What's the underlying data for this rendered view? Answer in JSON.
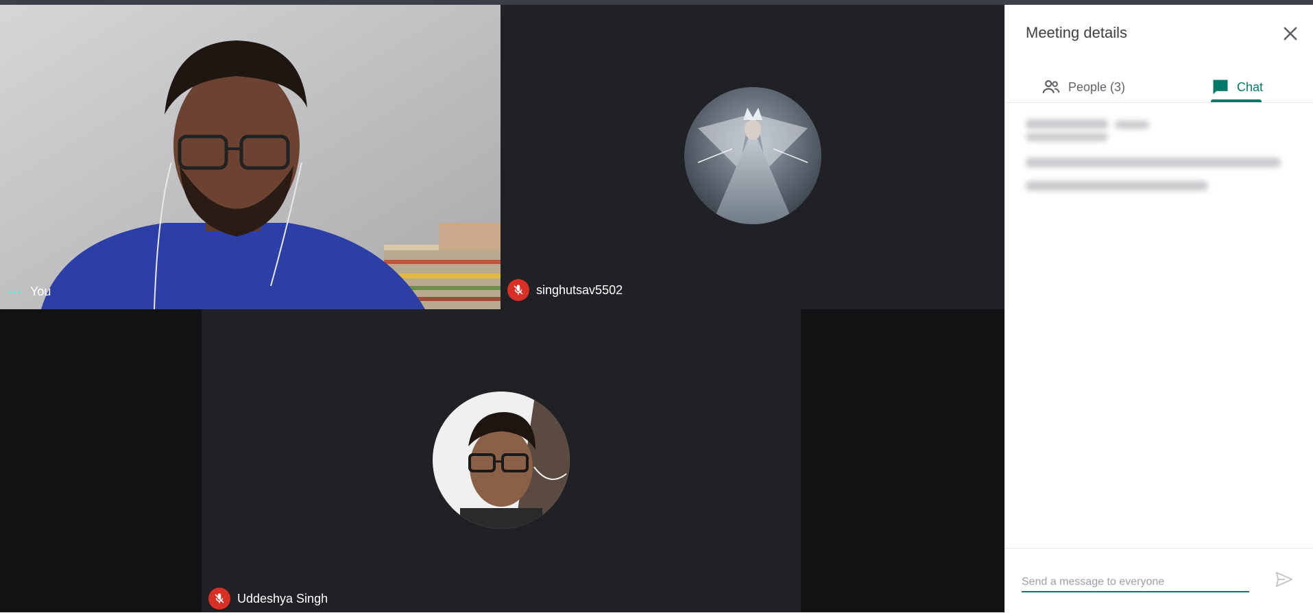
{
  "meeting": {
    "participants": [
      {
        "name": "You",
        "muted": false
      },
      {
        "name": "singhutsav5502",
        "muted": true
      },
      {
        "name": "Uddeshya Singh",
        "muted": true
      }
    ]
  },
  "panel": {
    "title": "Meeting details",
    "tabs": {
      "people_label": "People (3)",
      "chat_label": "Chat",
      "active": "Chat"
    },
    "chat_input": {
      "placeholder": "Send a message to everyone",
      "value": ""
    }
  },
  "colors": {
    "accent": "#00796b",
    "mute_red": "#d93025",
    "tile_bg": "#202124"
  },
  "icons": {
    "close": "close-icon",
    "people": "people-icon",
    "chat": "chat-icon",
    "send": "send-icon",
    "mic_off": "mic-off-icon",
    "more": "more-options-icon"
  }
}
